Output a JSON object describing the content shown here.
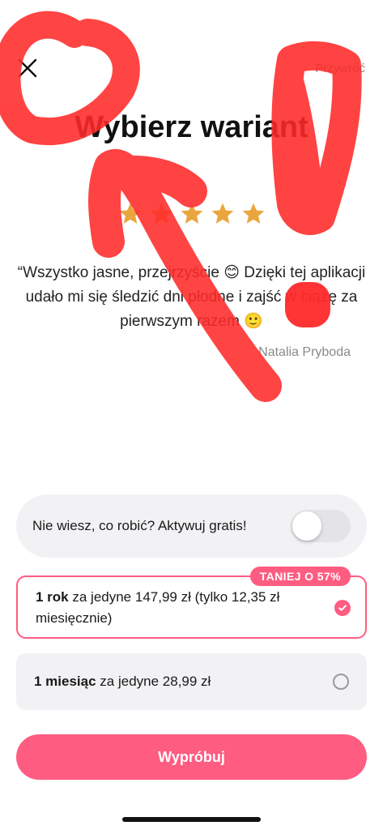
{
  "header": {
    "close_icon": "close-icon",
    "restore_label": "Przywróć"
  },
  "title": "Wybierz wariant",
  "rating": {
    "stars": 5,
    "color": "#eaa63e"
  },
  "review": {
    "text": "“Wszystko jasne, przejrzyście 😊 Dzięki tej aplikacji udało mi się śledzić dni płodne i zajść w ciążę za pierwszym razem 🙂",
    "author": "Natalia Pryboda"
  },
  "trial": {
    "label": "Nie wiesz, co robić? Aktywuj gratis!",
    "enabled": false
  },
  "plans": [
    {
      "period": "1 rok",
      "description": " za jedyne 147,99 zł (tylko 12,35 zł miesięcznie)",
      "badge": "TANIEJ O 57%",
      "selected": true
    },
    {
      "period": "1 miesiąc",
      "description": " za jedyne 28,99 zł",
      "selected": false
    }
  ],
  "cta": {
    "label": "Wypróbuj"
  },
  "colors": {
    "accent": "#ff5c82",
    "annotation": "#ff2a2a",
    "card_bg": "#f2f2f5"
  }
}
